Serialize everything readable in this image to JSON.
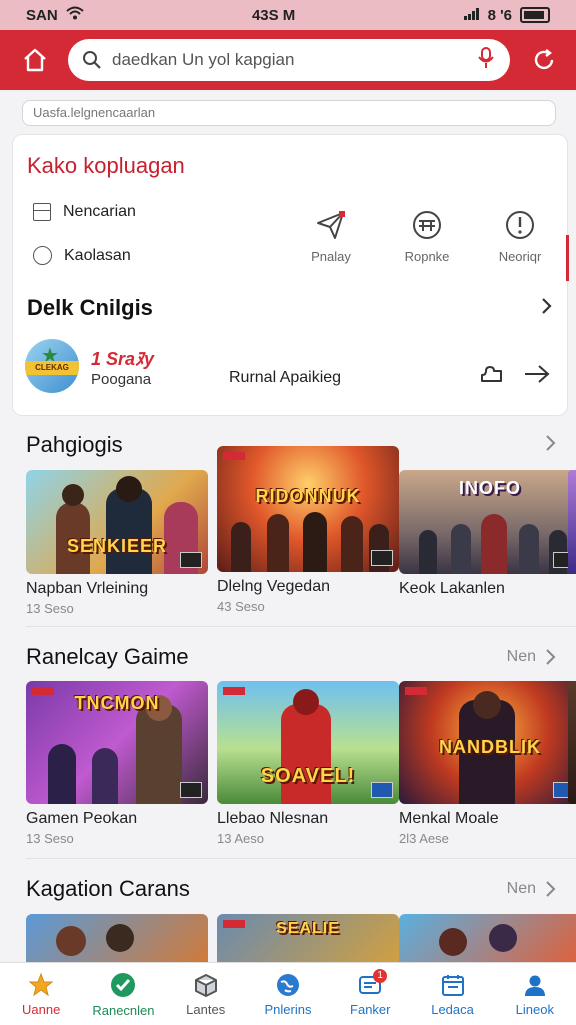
{
  "status_bar": {
    "carrier": "SAN",
    "time": "43S M",
    "right_text": "8 '6"
  },
  "search": {
    "query": "daedkan Un yol kapgian"
  },
  "search_hint": "Uasfa.lelgnencaarlan",
  "panel": {
    "title": "Kako kopluagan",
    "options": [
      "Nencarian",
      "Kaolasan"
    ],
    "quick_actions": [
      "Pnalay",
      "Ropnke",
      "Neoriqr"
    ],
    "daily": {
      "title": "Delk Cnilgis",
      "rank": "1 Sraﾇy",
      "subtitle": "Poogana",
      "middle_text": "Rurnal Apaikieg",
      "avatar_text": "CLEKAG"
    }
  },
  "sections": [
    {
      "title": "Pahgiogis",
      "more": "",
      "cards": [
        {
          "art_title": "SENKIEER",
          "name": "Napban Vrleining",
          "sub": "13 Seso"
        },
        {
          "art_title": "RIDONNUK",
          "name": "Dlelng Vegedan",
          "sub": "43 Seso"
        },
        {
          "art_title": "INOFO",
          "name": "Keok Lakanlen",
          "sub": ""
        }
      ]
    },
    {
      "title": "Ranelcay Gaime",
      "more": "Nen",
      "cards": [
        {
          "art_title": "TNCMON",
          "name": "Gamen Peokan",
          "sub": "13 Seso"
        },
        {
          "art_title": "SOAVEL!",
          "name": "Llebao Nlesnan",
          "sub": "13 Aeso"
        },
        {
          "art_title": "NANDBLIK",
          "name": "Menkal Moale",
          "sub": "2l3 Aese"
        }
      ]
    },
    {
      "title": "Kagation Carans",
      "more": "Nen",
      "cards": [
        {
          "art_title": "",
          "name": "",
          "sub": ""
        },
        {
          "art_title": "SEALIE",
          "name": "",
          "sub": ""
        },
        {
          "art_title": "",
          "name": "",
          "sub": ""
        }
      ]
    }
  ],
  "bottom_nav": [
    {
      "label": "Uanne",
      "icon": "star-icon"
    },
    {
      "label": "Ranecnlen",
      "icon": "check-icon"
    },
    {
      "label": "Lantes",
      "icon": "box-icon"
    },
    {
      "label": "Pnlerins",
      "icon": "globe-icon"
    },
    {
      "label": "Fanker",
      "icon": "message-icon",
      "badge": "1"
    },
    {
      "label": "Ledaca",
      "icon": "calendar-icon"
    },
    {
      "label": "Lineok",
      "icon": "user-icon"
    }
  ],
  "colors": {
    "accent": "#d42a35",
    "green": "#1f8a55",
    "blue": "#1f73c6"
  }
}
